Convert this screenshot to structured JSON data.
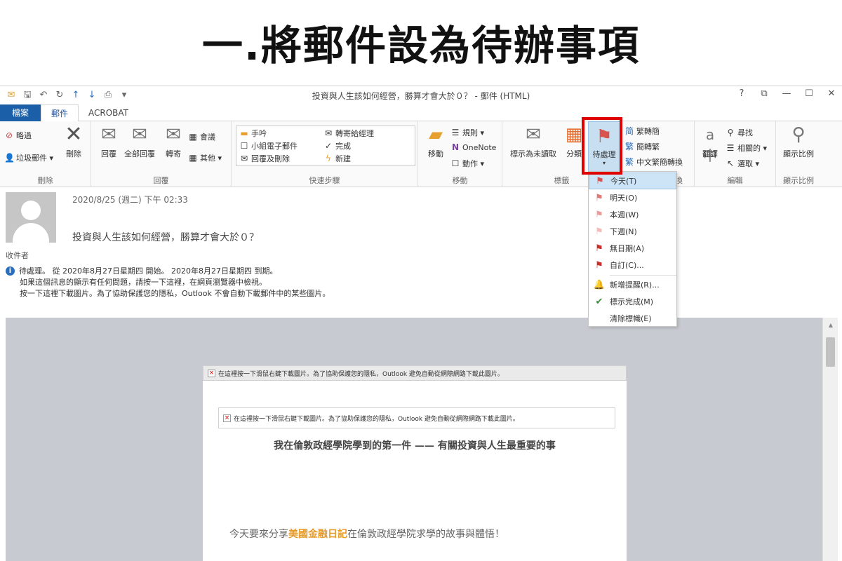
{
  "banner": {
    "title": "一.將郵件設為待辦事項"
  },
  "window": {
    "title": "投資與人生該如何經營，勝算才會大於０？ - 郵件 (HTML)",
    "controls": [
      "?",
      "⧉",
      "—",
      "☐",
      "✕"
    ]
  },
  "tabs": [
    "檔案",
    "郵件",
    "ACROBAT"
  ],
  "ribbon": {
    "delete_group": {
      "label": "刪除",
      "ignore": "略過",
      "junk": "垃圾郵件 ▾",
      "delete": "刪除"
    },
    "reply_group": {
      "label": "回覆",
      "reply": "回覆",
      "reply_all": "全部回覆",
      "forward": "轉寄",
      "meeting": "會議",
      "more": "其他 ▾"
    },
    "quicksteps_group": {
      "label": "快速步驟",
      "items": [
        "手吟",
        "小組電子郵件",
        "回覆及刪除",
        "轉寄給經理",
        "完成",
        "新建"
      ]
    },
    "move_group": {
      "label": "移動",
      "move": "移動",
      "rules": "規則 ▾",
      "onenote": "OneNote",
      "actions": "動作 ▾"
    },
    "tags_group": {
      "label": "標籤",
      "mark_unread": "標示為未讀取",
      "categorize": "分類",
      "followup": "待處理"
    },
    "chinese_group": {
      "trad_simp": "繁轉簡",
      "simp_trad": "簡轉繁",
      "convert": "中文繁簡轉換",
      "label": "換"
    },
    "editing_group": {
      "label": "編輯",
      "translate": "翻譯",
      "find": "尋找",
      "related": "相關的 ▾",
      "select": "選取 ▾"
    },
    "zoom_group": {
      "label": "顯示比例",
      "zoom": "顯示比例"
    }
  },
  "message": {
    "date": "2020/8/25 (週二) 下午 02:33",
    "subject": "投資與人生該如何經營，勝算才會大於０？",
    "sender_label": "收件者",
    "info_line1": "待處理。 從 2020年8月27日星期四 開始。 2020年8月27日星期四 到期。",
    "info_line2": "如果這個訊息的顯示有任何問題，請按一下這裡，在網頁瀏覽器中檢視。",
    "info_line3": "按一下這裡下載圖片。為了協助保護您的隱私，Outlook 不會自動下載郵件中的某些圖片。"
  },
  "email_body": {
    "image_notice": "在這裡按一下滑鼠右鍵下載圖片。為了協助保護您的隱私，Outlook 避免自動從網際網路下載此圖片。",
    "article_title": "我在倫敦政經學院學到的第一件 —— 有關投資與人生最重要的事",
    "intro_pre": "今天要來分享",
    "intro_highlight": "美國金融日記",
    "intro_post": "在倫敦政經學院求學的故事與體悟！"
  },
  "followup_menu": {
    "items": [
      "今天(T)",
      "明天(O)",
      "本週(W)",
      "下週(N)",
      "無日期(A)",
      "自訂(C)...",
      "新增提醒(R)...",
      "標示完成(M)",
      "清除標幟(E)"
    ]
  },
  "colors": {
    "accent": "#1a5fa8",
    "highlight_box": "#e00000",
    "flag": "#d9534f",
    "selected_item": "#cde4f7"
  }
}
